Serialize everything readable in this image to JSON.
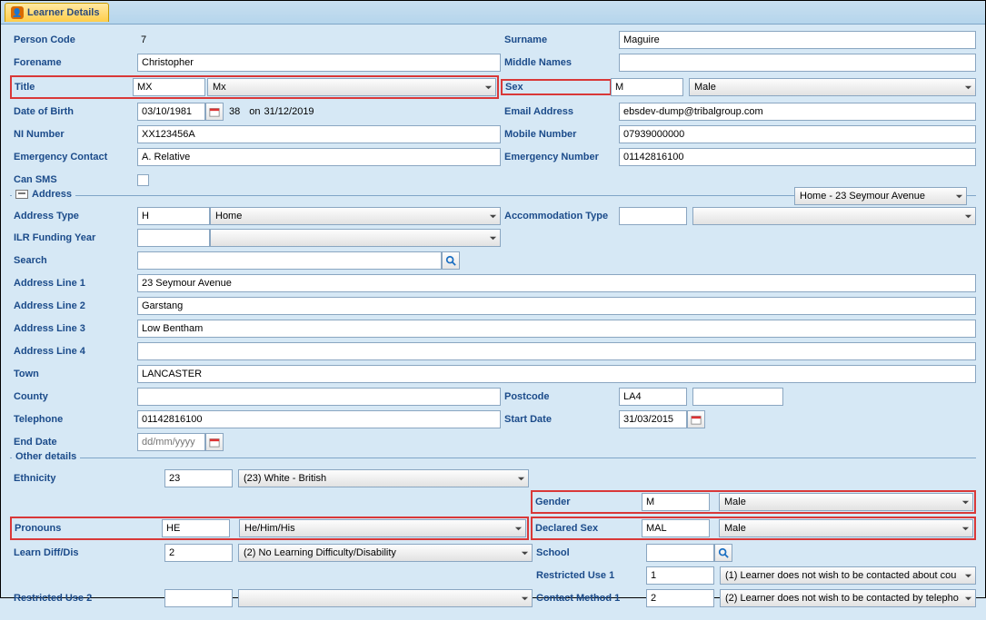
{
  "window": {
    "title": "Learner Details"
  },
  "person": {
    "labels": {
      "person_code": "Person Code",
      "surname": "Surname",
      "forename": "Forename",
      "middle_names": "Middle Names",
      "title": "Title",
      "sex": "Sex",
      "dob": "Date of Birth",
      "email": "Email Address",
      "ni": "NI Number",
      "mobile": "Mobile Number",
      "emergency_contact": "Emergency Contact",
      "emergency_number": "Emergency Number",
      "can_sms": "Can SMS"
    },
    "person_code": "7",
    "surname": "Maguire",
    "forename": "Christopher",
    "middle_names": "",
    "title_code": "MX",
    "title_text": "Mx",
    "sex_code": "M",
    "sex_text": "Male",
    "dob": "03/10/1981",
    "dob_age": "38",
    "dob_on_label": "on",
    "dob_on_date": "31/12/2019",
    "email": "ebsdev-dump@tribalgroup.com",
    "ni": "XX123456A",
    "mobile": "07939000000",
    "emergency_contact": "A. Relative",
    "emergency_number": "01142816100"
  },
  "address": {
    "section_label": "Address",
    "selector": "Home - 23 Seymour Avenue",
    "labels": {
      "type": "Address Type",
      "accommodation": "Accommodation Type",
      "ilr": "ILR Funding Year",
      "search": "Search",
      "line1": "Address Line 1",
      "line2": "Address Line 2",
      "line3": "Address Line 3",
      "line4": "Address Line 4",
      "town": "Town",
      "county": "County",
      "postcode": "Postcode",
      "telephone": "Telephone",
      "start_date": "Start Date",
      "end_date": "End Date"
    },
    "type_code": "H",
    "type_text": "Home",
    "accommodation_code": "",
    "accommodation_text": "",
    "ilr_code": "",
    "ilr_text": "",
    "search": "",
    "line1": "23 Seymour Avenue",
    "line2": "Garstang",
    "line3": "Low Bentham",
    "line4": "",
    "town": "LANCASTER",
    "county": "",
    "postcode": "LA4",
    "postcode2": "",
    "telephone": "01142816100",
    "start_date": "31/03/2015",
    "end_date_placeholder": "dd/mm/yyyy"
  },
  "other": {
    "section_label": "Other details",
    "labels": {
      "ethnicity": "Ethnicity",
      "gender": "Gender",
      "pronouns": "Pronouns",
      "declared_sex": "Declared Sex",
      "learn_diff": "Learn Diff/Dis",
      "school": "School",
      "restricted1": "Restricted Use 1",
      "restricted2": "Restricted Use 2",
      "contact1": "Contact Method 1"
    },
    "ethnicity_code": "23",
    "ethnicity_text": "(23) White - British",
    "gender_code": "M",
    "gender_text": "Male",
    "pronouns_code": "HE",
    "pronouns_text": "He/Him/His",
    "declared_sex_code": "MAL",
    "declared_sex_text": "Male",
    "learn_diff_code": "2",
    "learn_diff_text": "(2) No Learning Difficulty/Disability",
    "school_code": "",
    "restricted1_code": "1",
    "restricted1_text": "(1) Learner does not wish to be contacted about cou",
    "restricted2_code": "",
    "restricted2_text": "",
    "contact1_code": "2",
    "contact1_text": "(2) Learner does not wish to be contacted by telepho"
  }
}
